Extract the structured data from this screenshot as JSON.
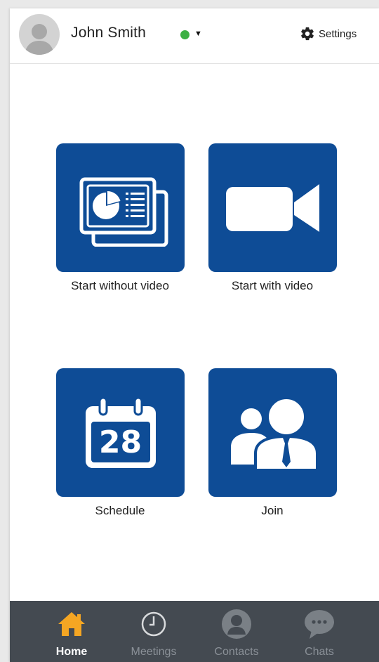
{
  "header": {
    "user_name": "John Smith",
    "status_color": "#3cb043",
    "settings_label": "Settings"
  },
  "tiles": [
    {
      "label": "Start without video",
      "icon": "screen-share-icon"
    },
    {
      "label": "Start with video",
      "icon": "video-camera-icon"
    },
    {
      "label": "Schedule",
      "icon": "calendar-icon",
      "calendar_day": "28"
    },
    {
      "label": "Join",
      "icon": "people-icon"
    }
  ],
  "tabbar": {
    "items": [
      {
        "label": "Home",
        "icon": "home-icon",
        "active": true
      },
      {
        "label": "Meetings",
        "icon": "clock-icon",
        "active": false
      },
      {
        "label": "Contacts",
        "icon": "contact-icon",
        "active": false
      },
      {
        "label": "Chats",
        "icon": "chat-bubble-icon",
        "active": false
      }
    ]
  },
  "colors": {
    "tile_blue": "#0e4c96",
    "accent_orange": "#f5a623",
    "tabbar_bg": "#444a51"
  }
}
